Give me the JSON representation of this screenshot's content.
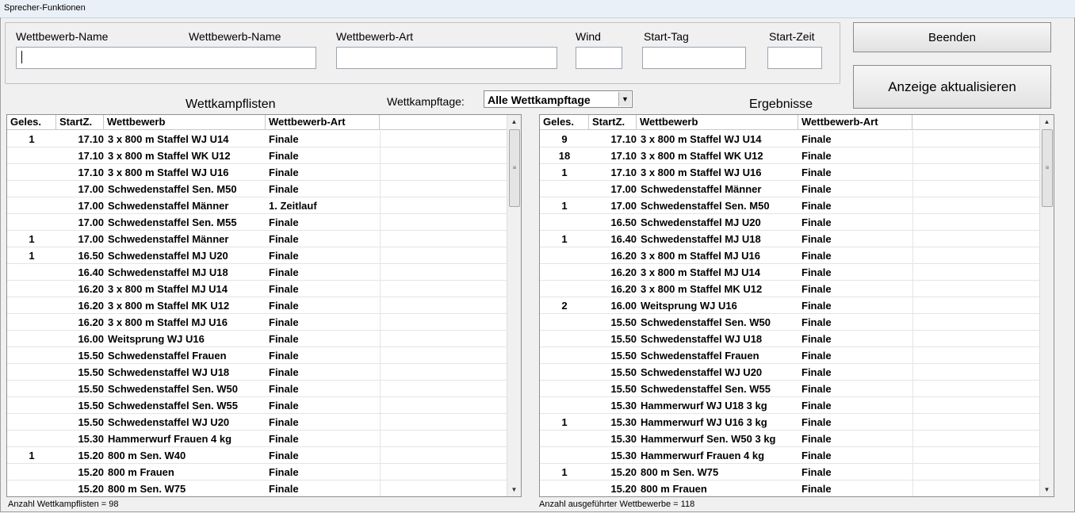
{
  "window": {
    "title": "Sprecher-Funktionen"
  },
  "form": {
    "labels": [
      "Wettbewerb-Name",
      "Wettbewerb-Name",
      "Wettbewerb-Art",
      "Wind",
      "Start-Tag",
      "Start-Zeit"
    ],
    "values": {
      "name": "",
      "art": "",
      "wind": "",
      "tag": "",
      "zeit": ""
    }
  },
  "buttons": {
    "beenden": "Beenden",
    "aktualisieren": "Anzeige aktualisieren"
  },
  "left_heading": "Wettkampflisten",
  "right_heading": "Ergebnisse",
  "filter": {
    "label": "Wettkampftage:",
    "selected": "Alle Wettkampftage"
  },
  "columns": [
    "Geles.",
    "StartZ.",
    "Wettbewerb",
    "Wettbewerb-Art"
  ],
  "left_rows": [
    [
      "1",
      "17.10",
      "3 x 800 m Staffel WJ U14",
      "Finale"
    ],
    [
      "",
      "17.10",
      "3 x 800 m Staffel WK U12",
      "Finale"
    ],
    [
      "",
      "17.10",
      "3 x 800 m Staffel WJ U16",
      "Finale"
    ],
    [
      "",
      "17.00",
      "Schwedenstaffel Sen. M50",
      "Finale"
    ],
    [
      "",
      "17.00",
      "Schwedenstaffel Männer",
      "1. Zeitlauf"
    ],
    [
      "",
      "17.00",
      "Schwedenstaffel Sen. M55",
      "Finale"
    ],
    [
      "1",
      "17.00",
      "Schwedenstaffel Männer",
      "Finale"
    ],
    [
      "1",
      "16.50",
      "Schwedenstaffel MJ U20",
      "Finale"
    ],
    [
      "",
      "16.40",
      "Schwedenstaffel MJ U18",
      "Finale"
    ],
    [
      "",
      "16.20",
      "3 x 800 m Staffel MJ U14",
      "Finale"
    ],
    [
      "",
      "16.20",
      "3 x 800 m Staffel MK U12",
      "Finale"
    ],
    [
      "",
      "16.20",
      "3 x 800 m Staffel MJ U16",
      "Finale"
    ],
    [
      "",
      "16.00",
      "Weitsprung WJ U16",
      "Finale"
    ],
    [
      "",
      "15.50",
      "Schwedenstaffel Frauen",
      "Finale"
    ],
    [
      "",
      "15.50",
      "Schwedenstaffel WJ U18",
      "Finale"
    ],
    [
      "",
      "15.50",
      "Schwedenstaffel Sen. W50",
      "Finale"
    ],
    [
      "",
      "15.50",
      "Schwedenstaffel Sen. W55",
      "Finale"
    ],
    [
      "",
      "15.50",
      "Schwedenstaffel WJ U20",
      "Finale"
    ],
    [
      "",
      "15.30",
      "Hammerwurf Frauen 4 kg",
      "Finale"
    ],
    [
      "1",
      "15.20",
      "800 m Sen. W40",
      "Finale"
    ],
    [
      "",
      "15.20",
      "800 m Frauen",
      "Finale"
    ],
    [
      "",
      "15.20",
      "800 m Sen. W75",
      "Finale"
    ]
  ],
  "right_rows": [
    [
      "9",
      "17.10",
      "3 x 800 m Staffel WJ U14",
      "Finale"
    ],
    [
      "18",
      "17.10",
      "3 x 800 m Staffel WK U12",
      "Finale"
    ],
    [
      "1",
      "17.10",
      "3 x 800 m Staffel WJ U16",
      "Finale"
    ],
    [
      "",
      "17.00",
      "Schwedenstaffel Männer",
      "Finale"
    ],
    [
      "1",
      "17.00",
      "Schwedenstaffel Sen. M50",
      "Finale"
    ],
    [
      "",
      "16.50",
      "Schwedenstaffel MJ U20",
      "Finale"
    ],
    [
      "1",
      "16.40",
      "Schwedenstaffel MJ U18",
      "Finale"
    ],
    [
      "",
      "16.20",
      "3 x 800 m Staffel MJ U16",
      "Finale"
    ],
    [
      "",
      "16.20",
      "3 x 800 m Staffel MJ U14",
      "Finale"
    ],
    [
      "",
      "16.20",
      "3 x 800 m Staffel MK U12",
      "Finale"
    ],
    [
      "2",
      "16.00",
      "Weitsprung WJ U16",
      "Finale"
    ],
    [
      "",
      "15.50",
      "Schwedenstaffel Sen. W50",
      "Finale"
    ],
    [
      "",
      "15.50",
      "Schwedenstaffel WJ U18",
      "Finale"
    ],
    [
      "",
      "15.50",
      "Schwedenstaffel Frauen",
      "Finale"
    ],
    [
      "",
      "15.50",
      "Schwedenstaffel WJ U20",
      "Finale"
    ],
    [
      "",
      "15.50",
      "Schwedenstaffel Sen. W55",
      "Finale"
    ],
    [
      "",
      "15.30",
      "Hammerwurf WJ U18 3 kg",
      "Finale"
    ],
    [
      "1",
      "15.30",
      "Hammerwurf WJ U16 3 kg",
      "Finale"
    ],
    [
      "",
      "15.30",
      "Hammerwurf Sen. W50 3 kg",
      "Finale"
    ],
    [
      "",
      "15.30",
      "Hammerwurf Frauen 4 kg",
      "Finale"
    ],
    [
      "1",
      "15.20",
      "800 m Sen. W75",
      "Finale"
    ],
    [
      "",
      "15.20",
      "800 m Frauen",
      "Finale"
    ]
  ],
  "status": {
    "left": "Anzahl Wettkampflisten =   98",
    "right": "Anzahl ausgeführter Wettbewerbe =   118"
  },
  "icons": {
    "up": "scroll-up-arrow-icon",
    "down": "scroll-down-arrow-icon",
    "combo": "dropdown-arrow-icon"
  }
}
